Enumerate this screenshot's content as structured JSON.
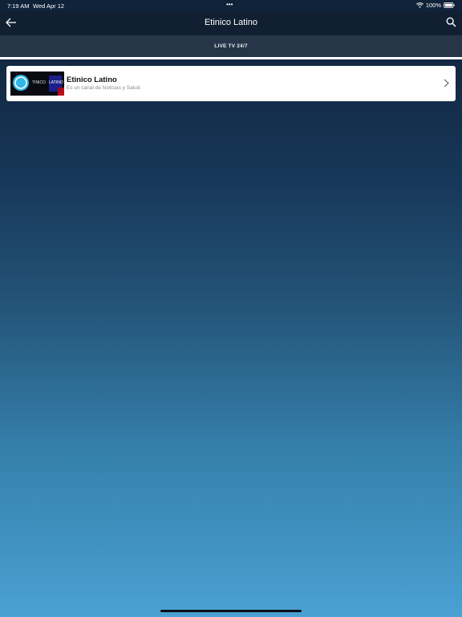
{
  "status_bar": {
    "time": "7:19 AM",
    "date": "Wed Apr 12",
    "multitask_dots": "•••",
    "battery": "100%",
    "icons": [
      "wifi-icon",
      "battery-icon"
    ]
  },
  "nav": {
    "title": "Etinico Latino",
    "back_icon": "back-arrow-icon",
    "search_icon": "search-icon"
  },
  "tabs": [
    {
      "label": "LIVE TV 24/7",
      "selected": true
    }
  ],
  "channels": [
    {
      "title": "Etinico Latino",
      "description": "Es un canal de Noticias y Salud.",
      "thumbnail": {
        "logo_letter": "e",
        "text_left": "TINICO",
        "text_right": "LATINO"
      },
      "chevron_icon": "chevron-right-icon"
    }
  ],
  "colors": {
    "nav_background": "#111f32",
    "tab_background": "#263547",
    "gradient_top": "#0f2238",
    "gradient_bottom": "#4aa1d3",
    "card_background": "#ffffff",
    "logo_cyan": "#2fb6e6"
  }
}
